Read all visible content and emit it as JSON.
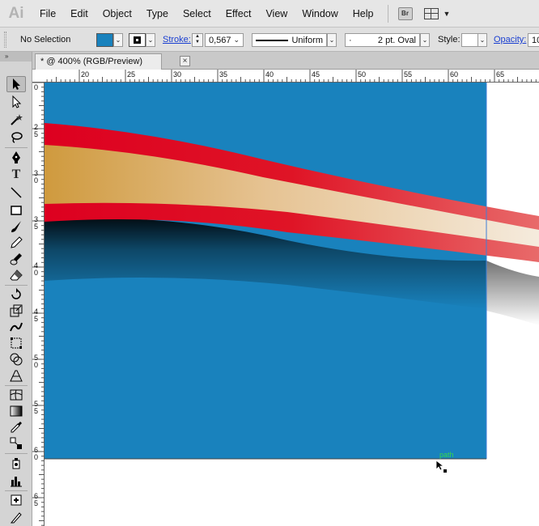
{
  "app": {
    "logo": "Ai"
  },
  "menu": [
    "File",
    "Edit",
    "Object",
    "Type",
    "Select",
    "Effect",
    "View",
    "Window",
    "Help"
  ],
  "menubar_extra": {
    "bridge_label": "Br"
  },
  "control": {
    "selection": "No Selection",
    "fill_color": "#1982bd",
    "stroke_label": "Stroke:",
    "stroke_weight": "0,567",
    "stroke_profile": "Uniform",
    "brush": "2 pt. Oval",
    "brush_dot": "·",
    "style_label": "Style:",
    "opacity_label": "Opacity:",
    "opacity_value": "10"
  },
  "document": {
    "tab_title": "* @ 400% (RGB/Preview)",
    "close_glyph": "×"
  },
  "ruler": {
    "h_labels": [
      "20",
      "25",
      "30",
      "35",
      "40",
      "45",
      "50",
      "55",
      "60",
      "65"
    ],
    "v_labels": [
      "0",
      "2\n5",
      "3\n0",
      "3\n5",
      "4\n0",
      "4\n5",
      "5\n0",
      "5\n5",
      "6\n0",
      "6\n5"
    ]
  },
  "canvas": {
    "artboard_color": "#1982bd",
    "stripe_red": "#e0001e",
    "stripe_tan_start": "#cf9a3e",
    "stripe_tan_end": "#f3e6d4",
    "hover_label": "path"
  },
  "colors": {
    "accent_link": "#1a3fd1"
  }
}
